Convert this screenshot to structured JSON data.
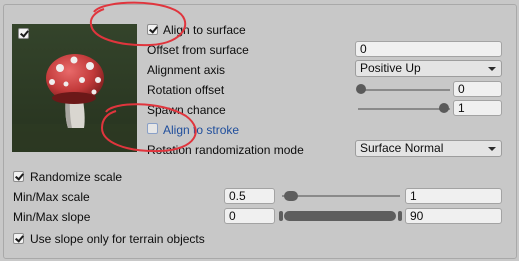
{
  "preview": {
    "enabled": true,
    "image": "mushroom-prefab-thumbnail"
  },
  "align_to_surface": {
    "label": "Align to surface",
    "checked": true
  },
  "offset_from_surface": {
    "label": "Offset from surface",
    "value": "0"
  },
  "alignment_axis": {
    "label": "Alignment axis",
    "value": "Positive Up"
  },
  "rotation_offset": {
    "label": "Rotation offset",
    "value": "0",
    "fraction": 0
  },
  "spawn_chance": {
    "label": "Spawn chance",
    "value": "1",
    "fraction": 1
  },
  "align_to_stroke": {
    "label": "Align to stroke",
    "checked": false
  },
  "rotation_randomization_mode": {
    "label": "Rotation randomization mode",
    "value": "Surface Normal"
  },
  "randomize_scale": {
    "label": "Randomize scale",
    "checked": true
  },
  "min_max_scale": {
    "label": "Min/Max scale",
    "min": "0.5",
    "max": "1"
  },
  "min_max_slope": {
    "label": "Min/Max slope",
    "min": "0",
    "max": "90"
  },
  "use_slope_terrain": {
    "label": "Use slope only for terrain objects",
    "checked": true
  },
  "colors": {
    "annotation": "#e0353d",
    "link": "#1f4e9c"
  }
}
